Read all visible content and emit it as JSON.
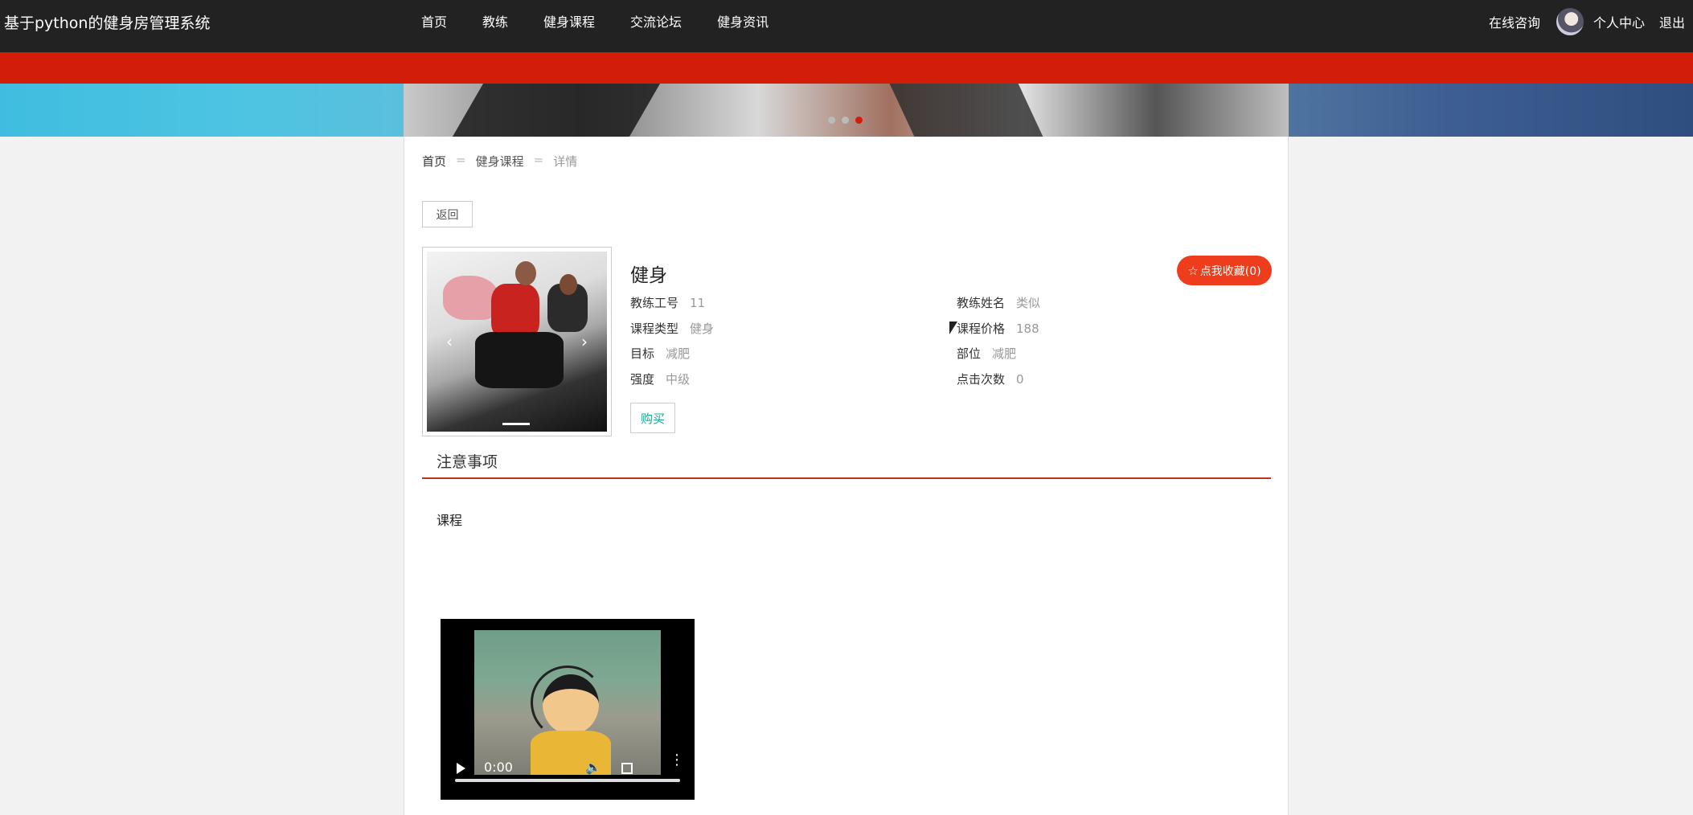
{
  "header": {
    "site_title": "基于python的健身房管理系统",
    "nav": [
      "首页",
      "教练",
      "健身课程",
      "交流论坛",
      "健身资讯"
    ],
    "online_consult": "在线咨询",
    "personal_center": "个人中心",
    "logout": "退出"
  },
  "banner": {
    "slide_count": 3,
    "active_slide": 3
  },
  "breadcrumb": {
    "home": "首页",
    "sep": "=",
    "parent": "健身课程",
    "current": "详情"
  },
  "back_label": "返回",
  "course": {
    "title": "健身",
    "favorite_label": "点我收藏(0)",
    "attrs": [
      {
        "key": "教练工号",
        "value": "11"
      },
      {
        "key": "教练姓名",
        "value": "类似"
      },
      {
        "key": "课程类型",
        "value": "健身"
      },
      {
        "key": "课程价格",
        "value": "188"
      },
      {
        "key": "目标",
        "value": "减肥"
      },
      {
        "key": "部位",
        "value": "减肥"
      },
      {
        "key": "强度",
        "value": "中级"
      },
      {
        "key": "点击次数",
        "value": "0"
      }
    ],
    "buy_label": "购买"
  },
  "notice": {
    "title": "注意事项",
    "section": "课程"
  },
  "video": {
    "time": "0:00"
  },
  "colors": {
    "nav_bg": "#222222",
    "accent_red": "#d21d08",
    "favorite": "#ee3d1c",
    "buy_text": "#1fa88b"
  }
}
